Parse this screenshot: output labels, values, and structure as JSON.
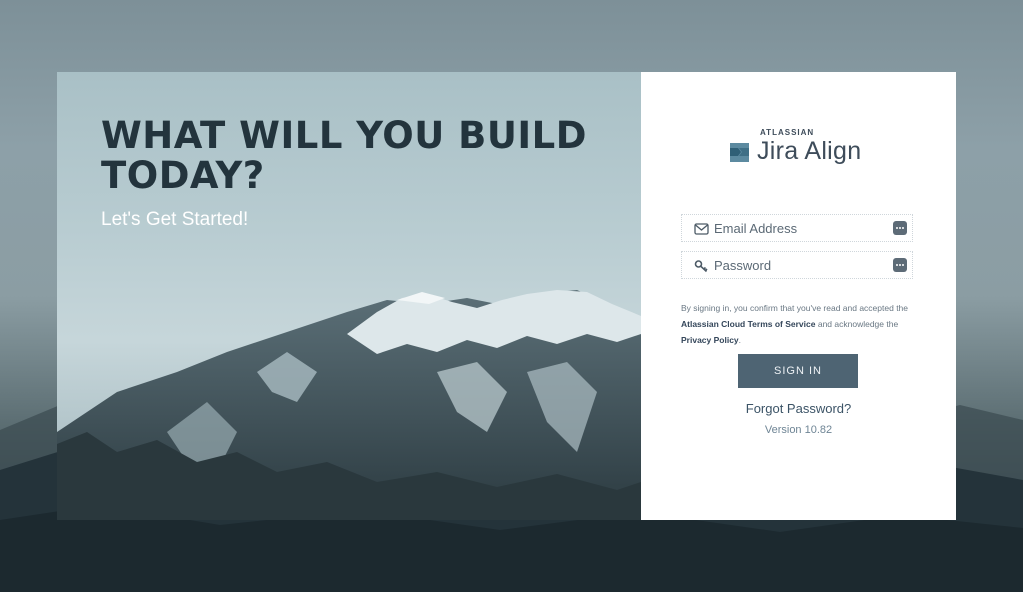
{
  "hero": {
    "headline": "WHAT WILL YOU BUILD TODAY?",
    "subheadline": "Let's Get Started!"
  },
  "brand": {
    "company": "ATLASSIAN",
    "product": "Jira Align",
    "logo_icon": "jira-align-logo-icon"
  },
  "login": {
    "email_placeholder": "Email Address",
    "password_placeholder": "Password",
    "email_icon": "envelope-icon",
    "password_icon": "key-icon",
    "password_manager_icon": "dots-icon",
    "legal_prefix": "By signing in, you confirm that you've read and accepted the",
    "terms_link": "Atlassian Cloud Terms of Service",
    "legal_middle": "and acknowledge the",
    "privacy_link": "Privacy Policy",
    "legal_suffix": ".",
    "signin_label": "SIGN IN",
    "forgot_label": "Forgot Password?",
    "version": "Version 10.82"
  },
  "colors": {
    "headline": "#23343d",
    "button": "#4e6473",
    "brand_text": "#3e4c5a",
    "link": "#3b5366"
  }
}
